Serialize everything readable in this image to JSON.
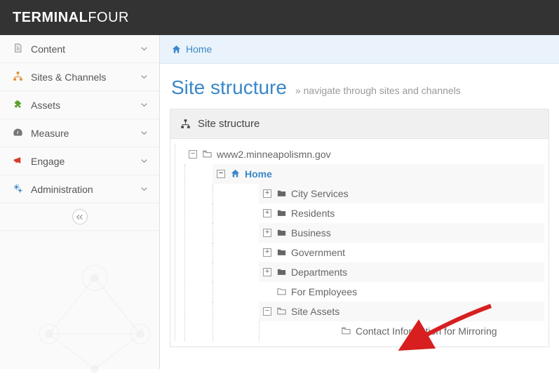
{
  "brand": {
    "part1": "TERMINAL",
    "part2": "FOUR"
  },
  "sidebar": {
    "items": [
      {
        "label": "Content",
        "icon": "document-icon",
        "color": "#888"
      },
      {
        "label": "Sites & Channels",
        "icon": "sitemap-icon",
        "color": "#e08a2c"
      },
      {
        "label": "Assets",
        "icon": "puzzle-icon",
        "color": "#5aa02c"
      },
      {
        "label": "Measure",
        "icon": "dashboard-icon",
        "color": "#777"
      },
      {
        "label": "Engage",
        "icon": "megaphone-icon",
        "color": "#d43b2a"
      },
      {
        "label": "Administration",
        "icon": "gears-icon",
        "color": "#3a87c8"
      }
    ]
  },
  "breadcrumb": {
    "home": "Home"
  },
  "page": {
    "title": "Site structure",
    "subtitle_prefix": "»",
    "subtitle": "navigate through sites and channels"
  },
  "panel": {
    "title": "Site structure"
  },
  "tree": {
    "root": {
      "label": "www2.minneapolismn.gov"
    },
    "home": {
      "label": "Home"
    },
    "children": [
      {
        "label": "City Services",
        "expandable": true,
        "icon": "folder-solid"
      },
      {
        "label": "Residents",
        "expandable": true,
        "icon": "folder-solid"
      },
      {
        "label": "Business",
        "expandable": true,
        "icon": "folder-solid"
      },
      {
        "label": "Government",
        "expandable": true,
        "icon": "folder-solid"
      },
      {
        "label": "Departments",
        "expandable": true,
        "icon": "folder-solid"
      },
      {
        "label": "For Employees",
        "expandable": false,
        "icon": "folder-outline"
      },
      {
        "label": "Site Assets",
        "expandable": true,
        "expanded": true,
        "icon": "folder-open-outline",
        "children": [
          {
            "label": "Contact Information for Mirroring",
            "icon": "folder-open-outline"
          }
        ]
      }
    ]
  }
}
